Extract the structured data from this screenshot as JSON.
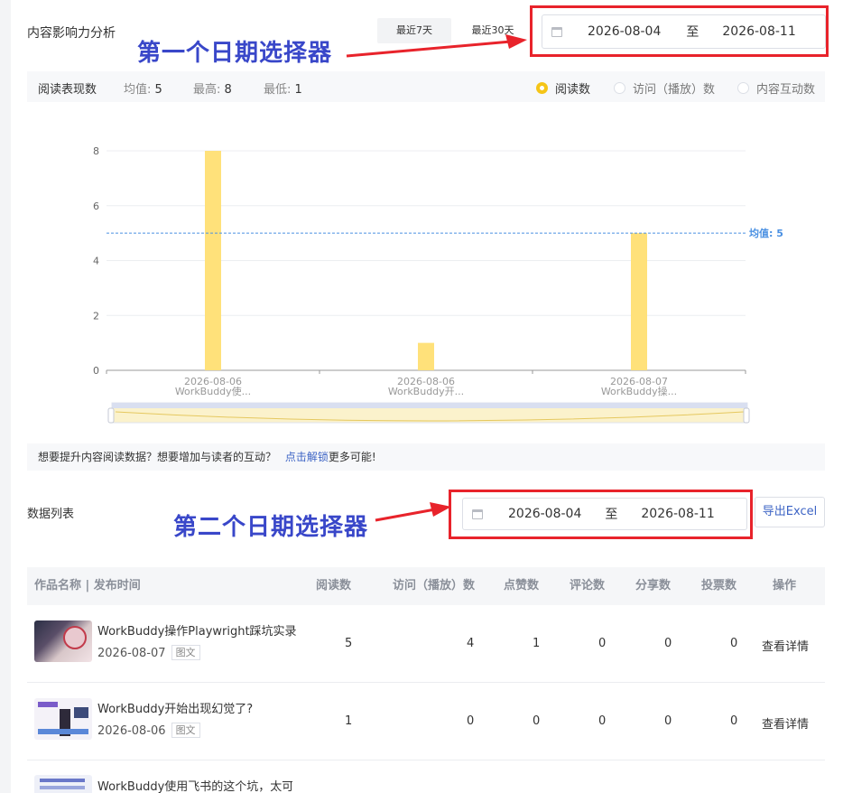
{
  "header": {
    "title": "内容影响力分析",
    "range_7": "最近7天",
    "range_30": "最近30天",
    "date_start": "2026-08-04",
    "date_sep": "至",
    "date_end": "2026-08-11"
  },
  "annotations": {
    "first": "第一个日期选择器",
    "second": "第二个日期选择器"
  },
  "stats": {
    "label": "阅读表现数",
    "avg_label": "均值:",
    "avg": "5",
    "max_label": "最高:",
    "max": "8",
    "min_label": "最低:",
    "min": "1",
    "metrics": [
      "阅读数",
      "访问（播放）数",
      "内容互动数"
    ],
    "selected_metric": "阅读数"
  },
  "chart_data": {
    "type": "bar",
    "categories": [
      [
        "2026-08-06",
        "WorkBuddy使..."
      ],
      [
        "2026-08-06",
        "WorkBuddy开..."
      ],
      [
        "2026-08-07",
        "WorkBuddy操..."
      ]
    ],
    "values": [
      8,
      1,
      5
    ],
    "ylim": [
      0,
      8
    ],
    "yticks": [
      0,
      2,
      4,
      6,
      8
    ],
    "mean_line": {
      "value": 5,
      "label": "均值: 5"
    },
    "grid": true,
    "bar_color": "#ffe17a"
  },
  "tip": {
    "text_before": "想要提升内容阅读数据？想要增加与读者的互动？",
    "link": "点击解锁",
    "text_after": "更多可能!"
  },
  "list": {
    "title": "数据列表",
    "date_start": "2026-08-04",
    "date_sep": "至",
    "date_end": "2026-08-11",
    "export": "导出Excel",
    "columns": [
      "作品名称 | 发布时间",
      "阅读数",
      "访问（播放）数",
      "点赞数",
      "评论数",
      "分享数",
      "投票数",
      "操作"
    ],
    "rows": [
      {
        "title": "WorkBuddy操作Playwright踩坑实录:",
        "date": "2026-08-07",
        "tag": "图文",
        "reads": "5",
        "visits": "4",
        "likes": "1",
        "comments": "0",
        "shares": "0",
        "votes": "0",
        "action": "查看详情"
      },
      {
        "title": "WorkBuddy开始出现幻觉了?",
        "date": "2026-08-06",
        "tag": "图文",
        "reads": "1",
        "visits": "0",
        "likes": "0",
        "comments": "0",
        "shares": "0",
        "votes": "0",
        "action": "查看详情"
      },
      {
        "title": "WorkBuddy使用飞书的这个坑，太可",
        "date": "",
        "tag": "",
        "reads": "",
        "visits": "",
        "likes": "",
        "comments": "",
        "shares": "",
        "votes": "",
        "action": ""
      }
    ]
  },
  "colors": {
    "accent_red": "#e8232b",
    "annotation_blue": "#3947c9",
    "link_blue": "#3d64c5",
    "bar_yellow": "#ffe17a",
    "mean_line_blue": "#4a90e2"
  }
}
